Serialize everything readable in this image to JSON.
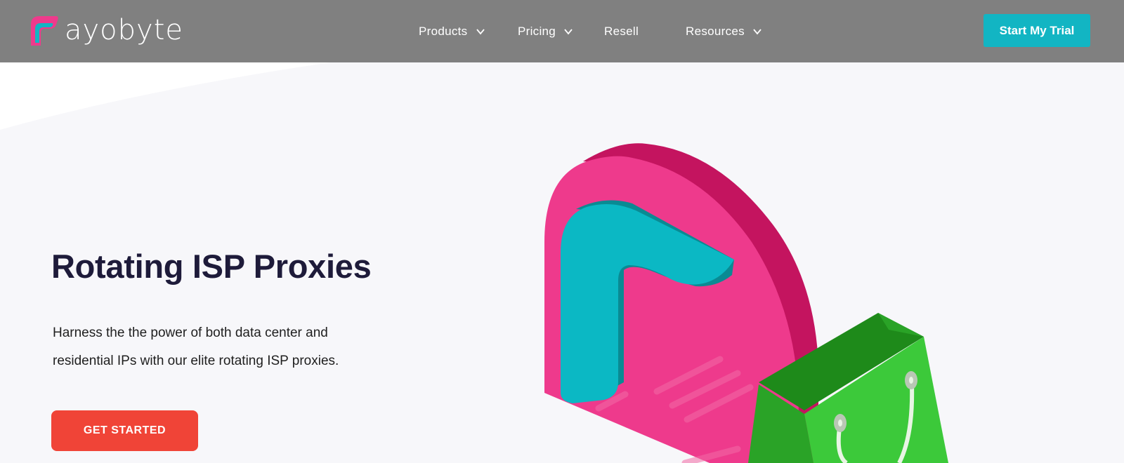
{
  "brand": {
    "name": "ayobyte"
  },
  "nav": {
    "items": [
      {
        "label": "Products",
        "has_dropdown": true
      },
      {
        "label": "Pricing",
        "has_dropdown": true
      },
      {
        "label": "Resell",
        "has_dropdown": false
      },
      {
        "label": "Resources",
        "has_dropdown": true
      }
    ],
    "cta_label": "Start My Trial"
  },
  "hero": {
    "title": "Rotating ISP Proxies",
    "description_line1": "Harness the the power of both data center and",
    "description_line2": "residential IPs with our elite rotating ISP proxies.",
    "cta_label": "GET STARTED",
    "illustration_icons": [
      "ayobyte-logo-block-icon",
      "shopping-bag-icon"
    ]
  },
  "colors": {
    "nav_bg": "#808080",
    "accent_teal": "#12b5c3",
    "cta_red": "#f04437",
    "brand_pink": "#ee3a8c",
    "bag_green": "#3cc93a",
    "title": "#1e1b3a"
  }
}
